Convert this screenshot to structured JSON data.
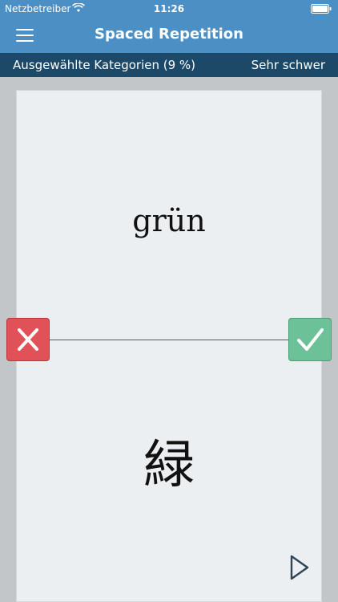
{
  "status_bar": {
    "carrier": "Netzbetreiber",
    "time": "11:26"
  },
  "nav": {
    "title": "Spaced Repetition",
    "menu_icon": "hamburger-menu-icon"
  },
  "sub_bar": {
    "categories": "Ausgewählte Kategorien (9 %)",
    "difficulty": "Sehr schwer"
  },
  "card": {
    "question": "grün",
    "answer": "緑"
  },
  "actions": {
    "wrong_icon": "x-icon",
    "right_icon": "checkmark-icon",
    "next_icon": "play-next-icon"
  },
  "colors": {
    "nav_blue": "#4b8fc5",
    "sub_bar_navy": "#1d4968",
    "wrong_red": "#e05257",
    "right_green": "#6cc199"
  }
}
